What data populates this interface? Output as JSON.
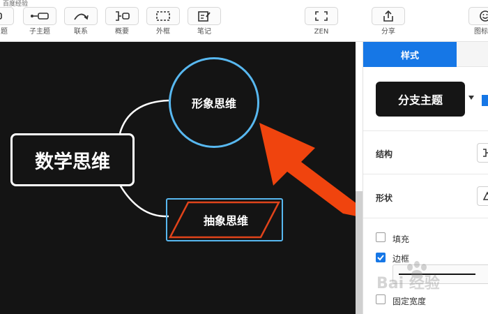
{
  "toolbar": {
    "top_partial_text": "百度经验",
    "items": [
      {
        "name": "topic",
        "label": "题"
      },
      {
        "name": "subtopic",
        "label": "子主题"
      },
      {
        "name": "relationship",
        "label": "联系"
      },
      {
        "name": "summary",
        "label": "概要"
      },
      {
        "name": "boundary",
        "label": "外框"
      },
      {
        "name": "note",
        "label": "笔记"
      },
      {
        "name": "zen",
        "label": "ZEN"
      },
      {
        "name": "share",
        "label": "分享"
      },
      {
        "name": "icon",
        "label": "图标"
      }
    ]
  },
  "canvas": {
    "root_topic": "数学思维",
    "branch_top": "形象思维",
    "branch_bottom": "抽象思维"
  },
  "panel": {
    "tab_style": "样式",
    "branch_theme": "分支主题",
    "structure_label": "结构",
    "shape_label": "形状",
    "fill_label": "填充",
    "fill_checked": false,
    "border_label": "边框",
    "border_checked": true,
    "fixed_width_label": "固定宽度",
    "fixed_width_checked": false
  },
  "watermark": {
    "text": "Bai 经验"
  },
  "colors": {
    "accent": "#1677e6",
    "canvas_bg": "#141414",
    "selection": "#58b8f0",
    "arrow": "#f0440e",
    "parallelogram_border": "#e0431a"
  }
}
